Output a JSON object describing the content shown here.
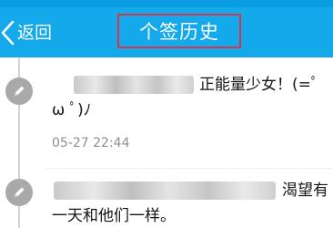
{
  "header": {
    "back_label": "返回",
    "title": "个签历史",
    "title_highlight_color": "#d8344a",
    "bar_color": "#14a9ea"
  },
  "items": [
    {
      "text_line1": "正能量少女！(=ﾟ",
      "text_line2": "ω ﾟ)ﾉ",
      "time": "05-27 22:44",
      "node_icon": "pencil-icon"
    },
    {
      "text_line1": "渴望有",
      "text_line2": "一天和他们一样。",
      "node_icon": "pencil-icon"
    }
  ]
}
